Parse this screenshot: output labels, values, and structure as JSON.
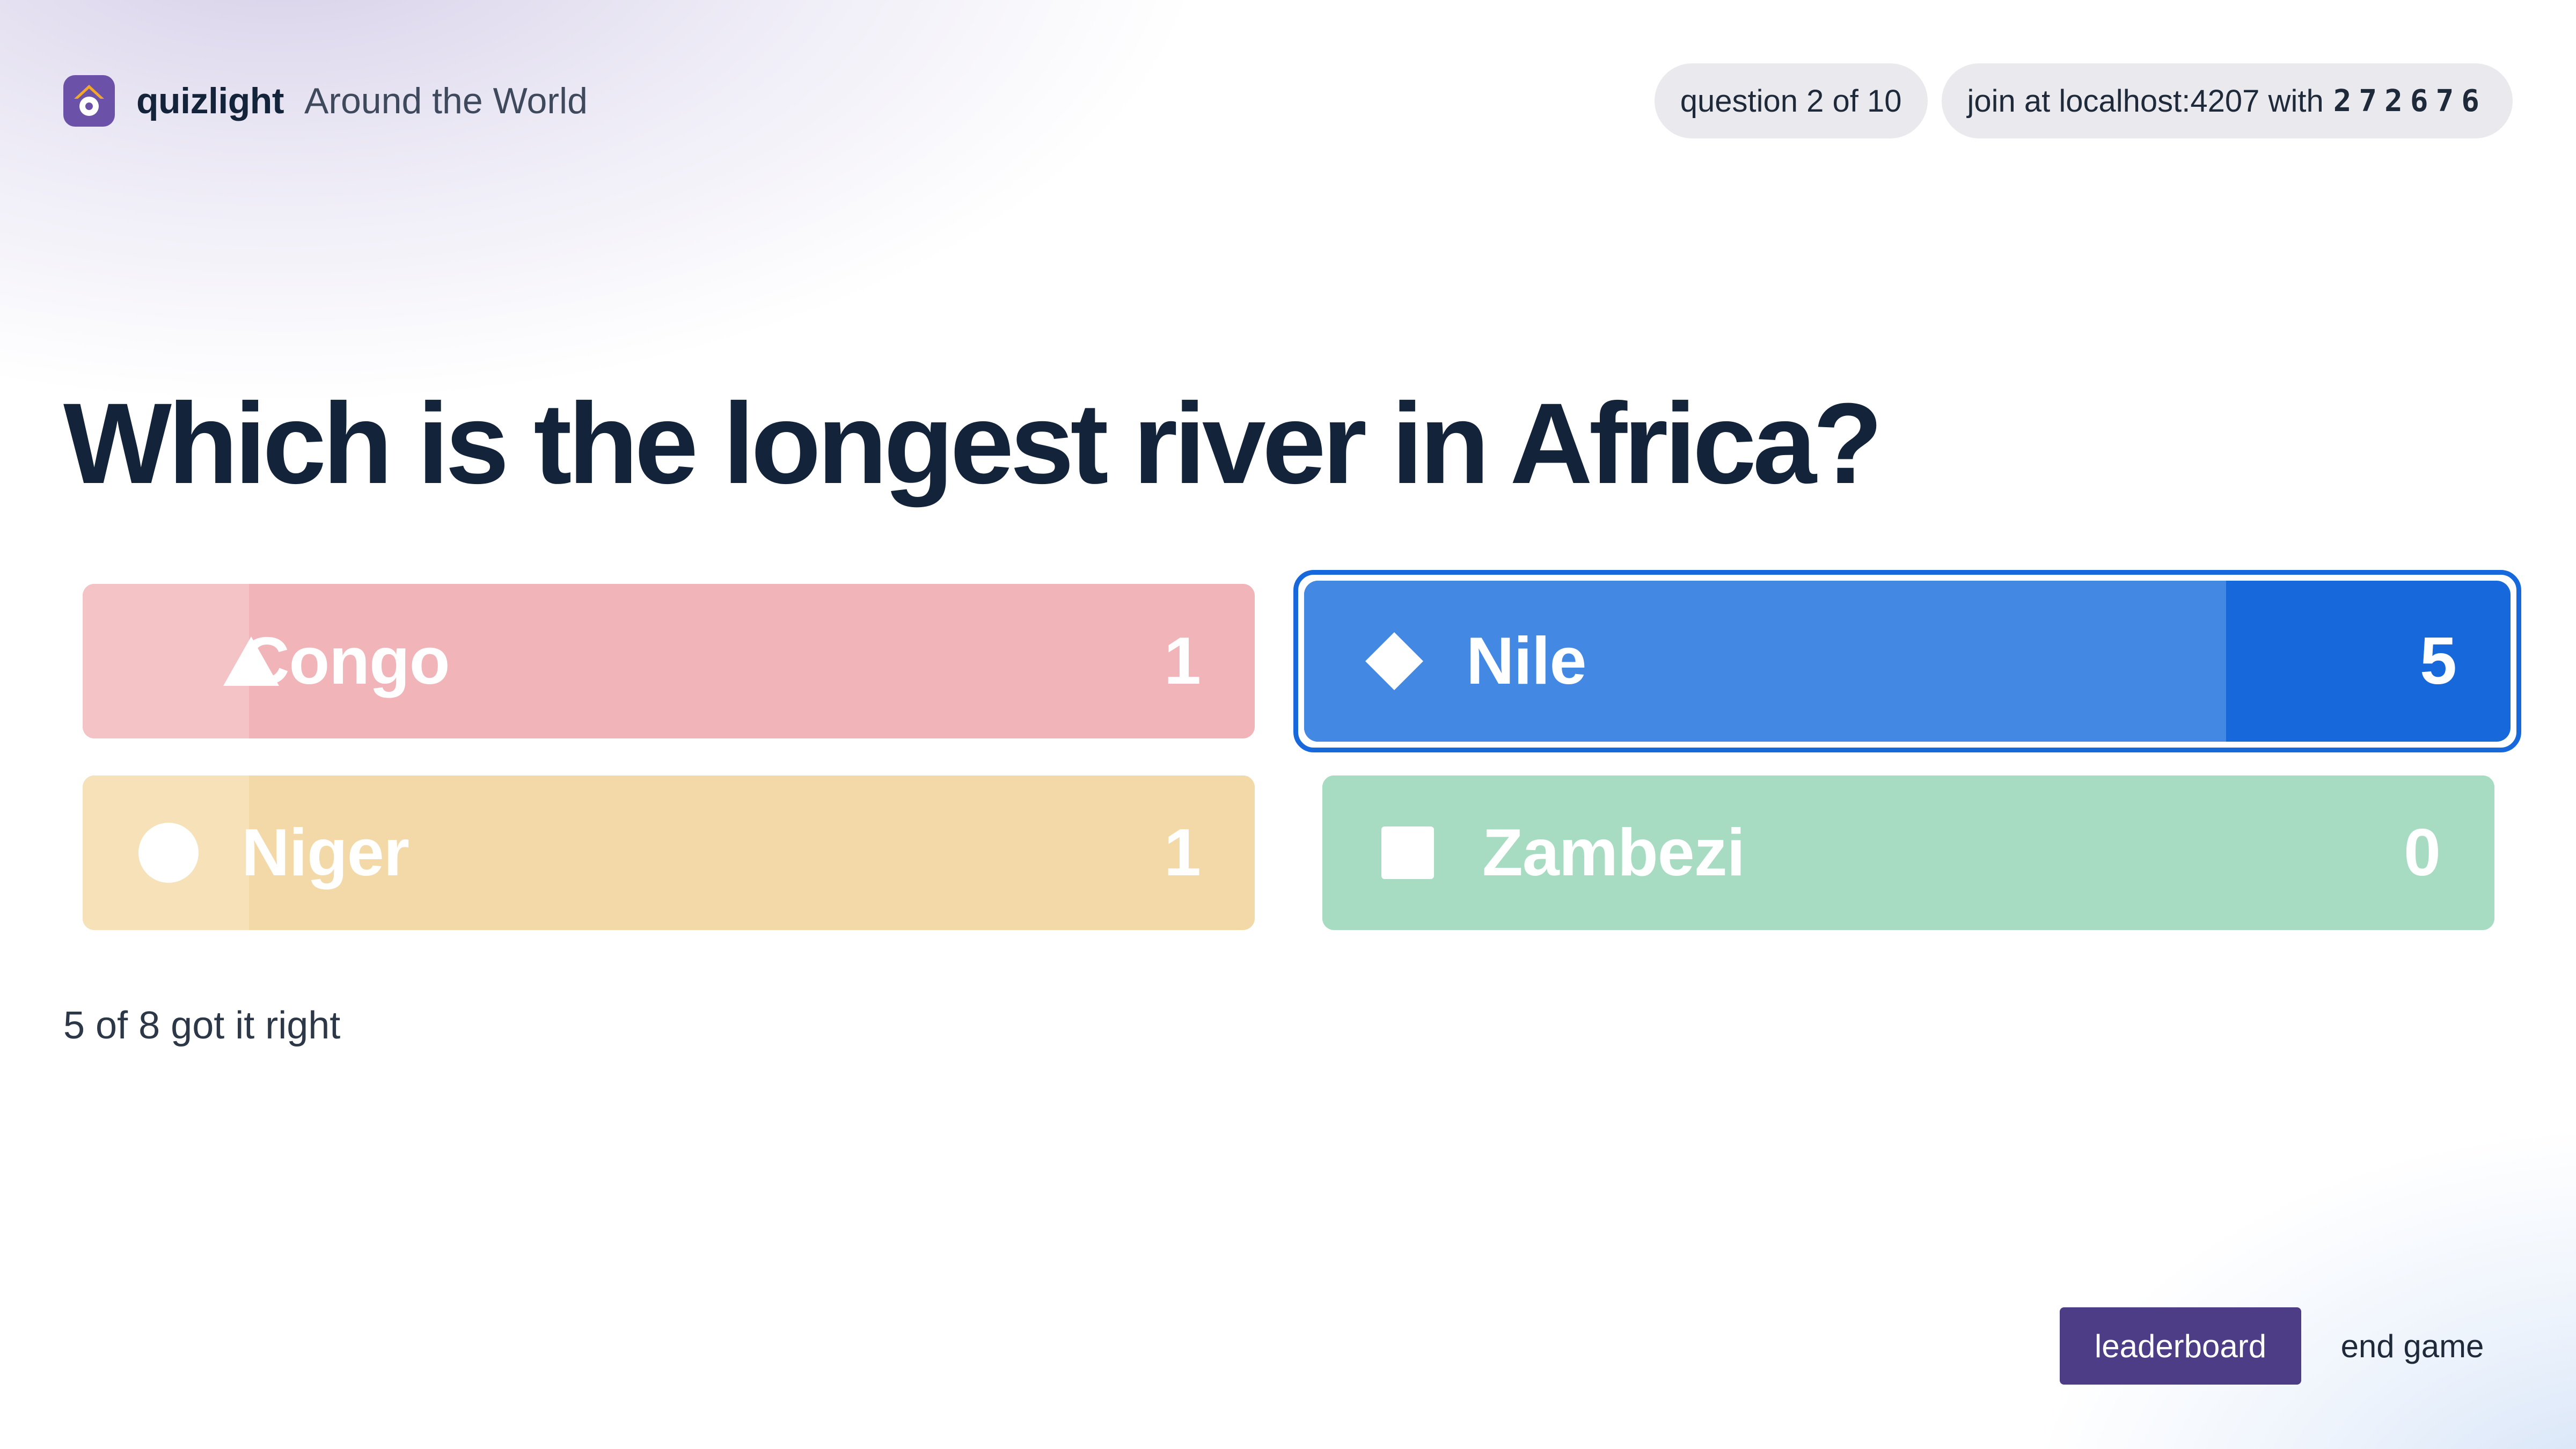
{
  "header": {
    "brand": "quizlight",
    "quiz_title": "Around the World",
    "progress": "question 2 of 10",
    "join_text": "join at localhost:4207 with",
    "game_pin": "272676"
  },
  "question": {
    "text": "Which is the longest river in Africa?"
  },
  "answers": [
    {
      "shape": "triangle-icon",
      "label": "Congo",
      "count": "1",
      "votes": 1,
      "correct": false,
      "color": "#f1b5b9"
    },
    {
      "shape": "diamond-icon",
      "label": "Nile",
      "count": "5",
      "votes": 5,
      "correct": true,
      "color": "#1769db"
    },
    {
      "shape": "circle-icon",
      "label": "Niger",
      "count": "1",
      "votes": 1,
      "correct": false,
      "color": "#f3d9a8"
    },
    {
      "shape": "square-icon",
      "label": "Zambezi",
      "count": "0",
      "votes": 0,
      "correct": false,
      "color": "#a7dbc2"
    }
  ],
  "summary": {
    "text": "5 of 8 got it right"
  },
  "actions": {
    "leaderboard_label": "leaderboard",
    "end_game_label": "end game"
  },
  "colors": {
    "brand": "#6b52a8",
    "primary_button": "#4d3c86",
    "correct_accent": "#1769db",
    "text": "#13243a"
  }
}
